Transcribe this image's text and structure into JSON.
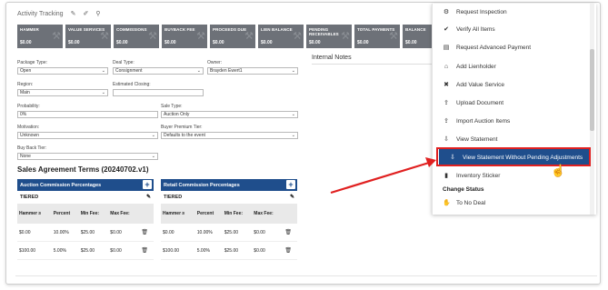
{
  "activity": {
    "label": "Activity Tracking"
  },
  "tiles": [
    {
      "label": "HAMMER",
      "value": "$0.00"
    },
    {
      "label": "VALUE SERVICES",
      "value": "$0.00"
    },
    {
      "label": "COMMISSIONS",
      "value": "$0.00"
    },
    {
      "label": "BUYBACK FEE",
      "value": "$0.00"
    },
    {
      "label": "PROCEEDS DUE",
      "value": "$0.00"
    },
    {
      "label": "LIEN BALANCE",
      "value": "$0.00"
    },
    {
      "label": "PENDING RECEIVABLES",
      "value": "$0.00"
    },
    {
      "label": "TOTAL PAYMENTS",
      "value": "$0.00"
    },
    {
      "label": "BALANCE",
      "value": "$0.00"
    }
  ],
  "form": {
    "package_type_label": "Package Type:",
    "package_type_value": "Open",
    "deal_type_label": "Deal Type:",
    "deal_type_value": "Consignment",
    "owner_label": "Owner:",
    "owner_value": "Brayden Ewert1",
    "region_label": "Region:",
    "region_value": "Main",
    "estimated_closing_label": "Estimated Closing:",
    "estimated_closing_value": "",
    "probability_label": "Probability:",
    "probability_value": "0%",
    "sale_type_label": "Sale Type:",
    "sale_type_value": "Auction Only",
    "motivation_label": "Motivation:",
    "motivation_value": "Unknown",
    "buyer_premium_label": "Buyer Premium Tier:",
    "buyer_premium_value": "Defaults to the event",
    "buy_back_label": "Buy Back Tier:",
    "buy_back_value": "None"
  },
  "internal_notes": "Internal Notes",
  "agreement_title": "Sales Agreement Terms (20240702.v1)",
  "auction_card": {
    "title": "Auction Commission Percentages",
    "tiered": "TIERED",
    "headers": [
      "Hammer ≥",
      "Percent",
      "Min Fee:",
      "Max Fee:"
    ],
    "rows": [
      [
        "$0.00",
        "10.00%",
        "$25.00",
        "$0.00"
      ],
      [
        "$100.00",
        "5.00%",
        "$25.00",
        "$0.00"
      ]
    ]
  },
  "retail_card": {
    "title": "Retail Commission Percentages",
    "tiered": "TIERED",
    "headers": [
      "Hammer ≥",
      "Percent",
      "Min Fee:",
      "Max Fee:"
    ],
    "rows": [
      [
        "$0.00",
        "10.00%",
        "$25.00",
        "$0.00"
      ],
      [
        "$100.00",
        "5.00%",
        "$25.00",
        "$0.00"
      ]
    ]
  },
  "menu": {
    "items": [
      {
        "label": "Request Inspection",
        "icon": "inspection-icon",
        "glyph": "⚙"
      },
      {
        "label": "Verify All Items",
        "icon": "check-circle-icon",
        "glyph": "✔"
      },
      {
        "label": "Request Advanced Payment",
        "icon": "payment-icon",
        "glyph": "▤"
      },
      {
        "label": "Add Lienholder",
        "icon": "bank-icon",
        "glyph": "⌂"
      },
      {
        "label": "Add Value Service",
        "icon": "value-service-icon",
        "glyph": "✖"
      },
      {
        "label": "Upload Document",
        "icon": "upload-icon",
        "glyph": "⇪"
      },
      {
        "label": "Import Auction Items",
        "icon": "import-icon",
        "glyph": "⇪"
      },
      {
        "label": "View Statement",
        "icon": "download-icon",
        "glyph": "⇩"
      },
      {
        "label": "View Statement Without Pending Adjustments",
        "icon": "download-icon",
        "glyph": "⇩"
      },
      {
        "label": "Inventory Sticker",
        "icon": "sticker-icon",
        "glyph": "▮"
      }
    ],
    "change_status_heading": "Change Status",
    "status_items": [
      {
        "label": "To No Deal",
        "icon": "thumbs-down-icon",
        "glyph": "✋"
      }
    ]
  },
  "colors": {
    "accent": "#1f4e8c",
    "highlight_border": "#e02020",
    "tile_bg": "#6d7178"
  }
}
